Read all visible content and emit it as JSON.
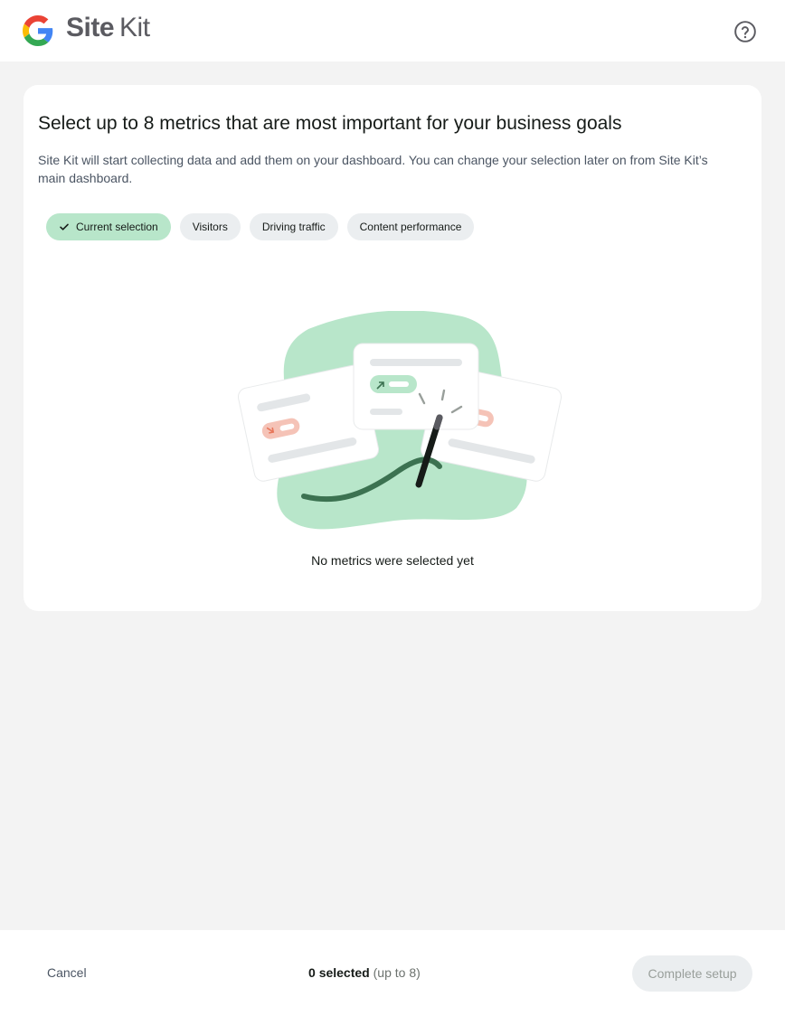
{
  "header": {
    "brand_site": "Site",
    "brand_kit": "Kit",
    "logo_icon": "google-g-icon",
    "help_icon": "help-circle-icon"
  },
  "main": {
    "title": "Select up to 8 metrics that are most important for your business goals",
    "description": "Site Kit will start collecting data and add them on your dashboard. You can change your selection later on from Site Kit’s main dashboard.",
    "chips": [
      {
        "label": "Current selection",
        "active": true,
        "icon": "check-icon"
      },
      {
        "label": "Visitors",
        "active": false
      },
      {
        "label": "Driving traffic",
        "active": false
      },
      {
        "label": "Content performance",
        "active": false
      }
    ],
    "empty_message": "No metrics were selected yet"
  },
  "footer": {
    "cancel_label": "Cancel",
    "selected_count": "0",
    "selected_label": "selected",
    "limit_label": "(up to 8)",
    "complete_label": "Complete setup"
  },
  "colors": {
    "active_chip": "#b8e6ca",
    "chip": "#ebeef0",
    "illustration_green": "#b8e6ca",
    "illustration_dark_green": "#3c7251",
    "illustration_salmon": "#f5c3b7"
  }
}
